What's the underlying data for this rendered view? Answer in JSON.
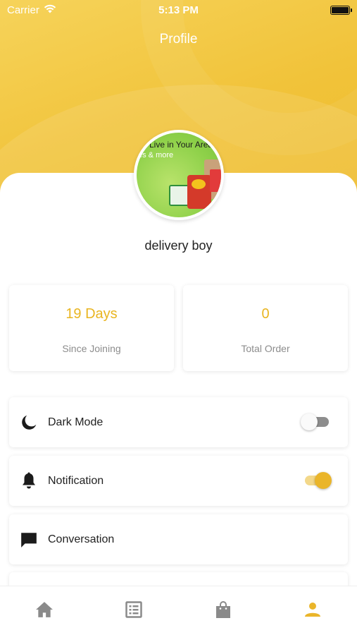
{
  "status_bar": {
    "carrier": "Carrier",
    "time": "5:13 PM"
  },
  "header": {
    "title": "Profile"
  },
  "avatar": {
    "banner_text": "Live in Your Area",
    "banner_sub": "es & more"
  },
  "profile": {
    "name": "delivery boy"
  },
  "stats": [
    {
      "value": "19 Days",
      "label": "Since Joining"
    },
    {
      "value": "0",
      "label": "Total Order"
    }
  ],
  "menu": [
    {
      "label": "Dark Mode",
      "icon": "moon-icon",
      "toggle": false
    },
    {
      "label": "Notification",
      "icon": "bell-icon",
      "toggle": true
    },
    {
      "label": "Conversation",
      "icon": "chat-icon"
    }
  ],
  "bottom_nav": {
    "items": [
      {
        "icon": "home-icon",
        "active": false
      },
      {
        "icon": "list-icon",
        "active": false
      },
      {
        "icon": "bag-icon",
        "active": false
      },
      {
        "icon": "person-icon",
        "active": true
      }
    ]
  },
  "colors": {
    "accent": "#eab52a",
    "inactive_icon": "#8a8a8a",
    "header": "#f1c33a"
  }
}
